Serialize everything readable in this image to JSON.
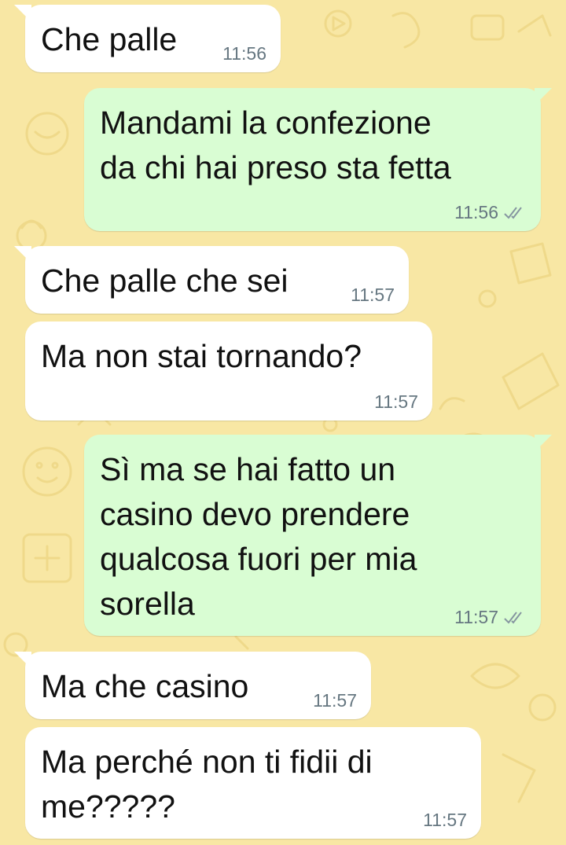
{
  "chat": {
    "messages": [
      {
        "direction": "incoming",
        "text": "Che palle",
        "time": "11:56"
      },
      {
        "direction": "outgoing",
        "text": "Mandami la confezione\nda chi hai preso sta fetta",
        "time": "11:56",
        "read_receipt": "double-check-icon"
      },
      {
        "direction": "incoming",
        "text": "Che palle che sei",
        "time": "11:57"
      },
      {
        "direction": "incoming",
        "text": "Ma non stai tornando?",
        "time": "11:57"
      },
      {
        "direction": "outgoing",
        "text": "Sì ma se hai fatto un\ncasino devo prendere\nqualcosa fuori per mia\nsorella",
        "time": "11:57",
        "read_receipt": "double-check-icon"
      },
      {
        "direction": "incoming",
        "text": "Ma che casino",
        "time": "11:57"
      },
      {
        "direction": "incoming",
        "text": "Ma perché non ti fidii di\nme?????",
        "time": "11:57"
      }
    ]
  },
  "colors": {
    "wallpaper": "#f8e7a4",
    "incoming_bubble": "#ffffff",
    "outgoing_bubble": "#d9fdd3",
    "timestamp": "#667781"
  }
}
